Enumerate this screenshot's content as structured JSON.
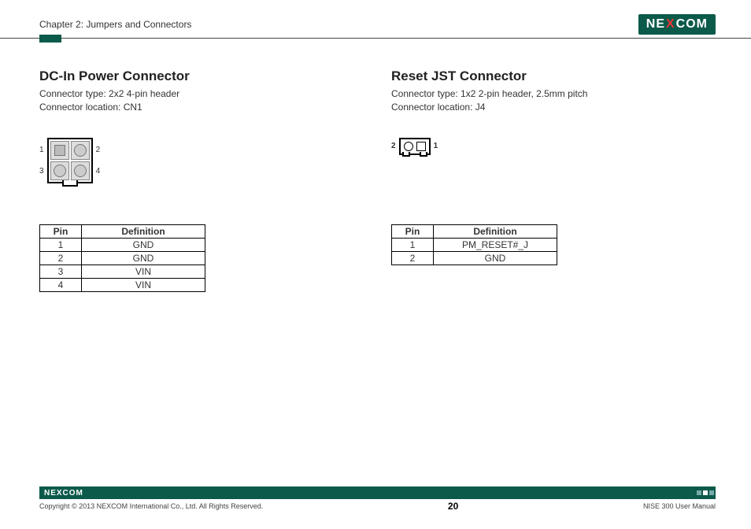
{
  "header": {
    "chapter": "Chapter 2: Jumpers and Connectors",
    "logo_pre": "NE",
    "logo_x": "X",
    "logo_post": "COM"
  },
  "left": {
    "title": "DC-In Power Connector",
    "type_line": "Connector type: 2x2 4-pin header",
    "loc_line": "Connector location: CN1",
    "pin_labels": {
      "p1": "1",
      "p2": "2",
      "p3": "3",
      "p4": "4"
    },
    "table": {
      "h1": "Pin",
      "h2": "Definition",
      "rows": [
        {
          "pin": "1",
          "def": "GND"
        },
        {
          "pin": "2",
          "def": "GND"
        },
        {
          "pin": "3",
          "def": "VIN"
        },
        {
          "pin": "4",
          "def": "VIN"
        }
      ]
    }
  },
  "right": {
    "title": "Reset JST Connector",
    "type_line": "Connector type: 1x2 2-pin header, 2.5mm pitch",
    "loc_line": "Connector location: J4",
    "pin_labels": {
      "p1": "1",
      "p2": "2"
    },
    "table": {
      "h1": "Pin",
      "h2": "Definition",
      "rows": [
        {
          "pin": "1",
          "def": "PM_RESET#_J"
        },
        {
          "pin": "2",
          "def": "GND"
        }
      ]
    }
  },
  "footer": {
    "logo": "NEXCOM",
    "copyright": "Copyright © 2013 NEXCOM International Co., Ltd. All Rights Reserved.",
    "page": "20",
    "manual": "NISE 300 User Manual"
  }
}
